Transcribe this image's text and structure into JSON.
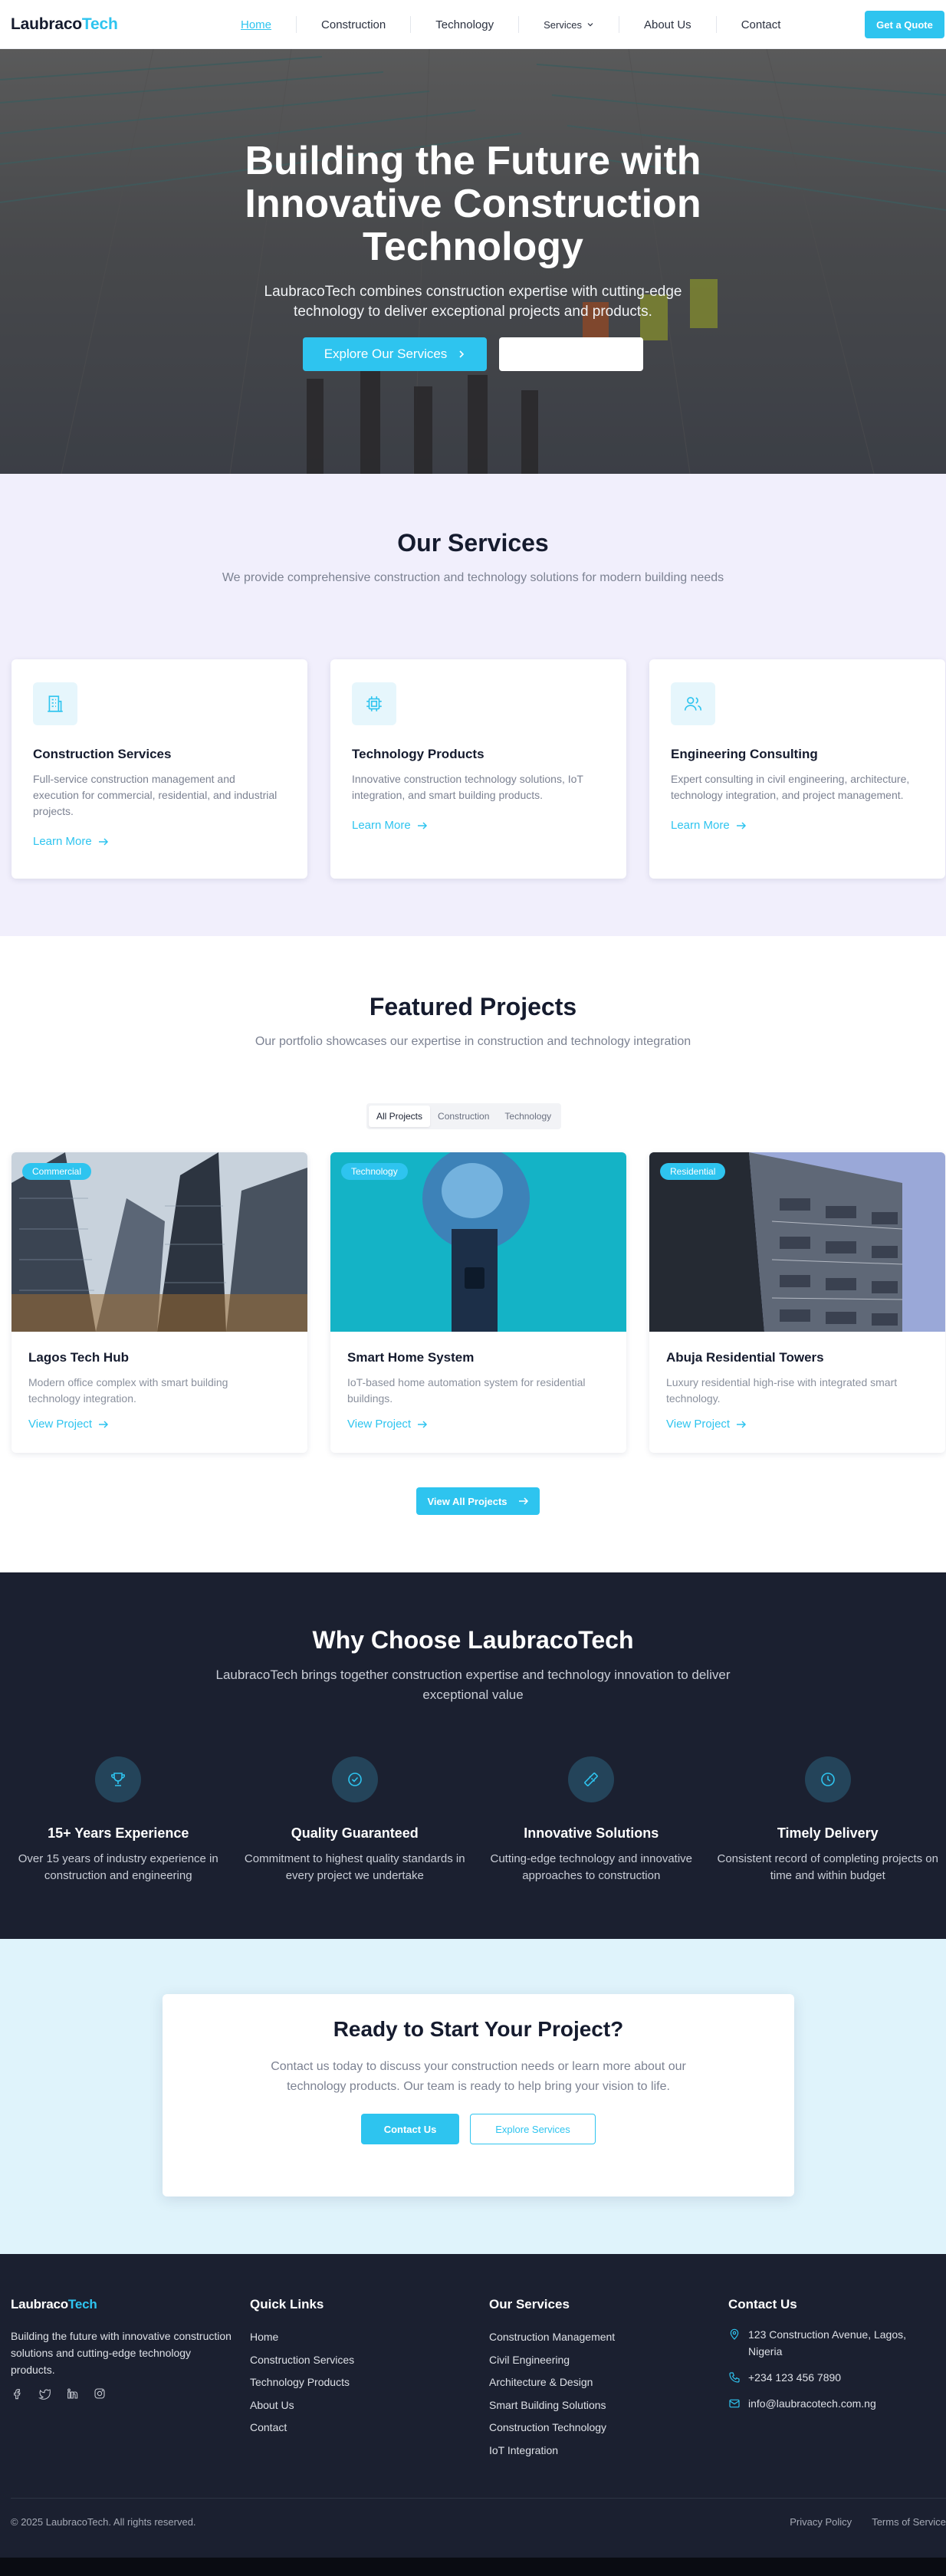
{
  "brand": {
    "part1": "Laubraco",
    "part2": "Tech"
  },
  "nav": {
    "items": [
      "Home",
      "Construction",
      "Technology",
      "Services",
      "About Us",
      "Contact"
    ],
    "quote_label": "Get a Quote"
  },
  "hero": {
    "title": "Building the Future with Innovative Construction Technology",
    "subtitle": "LaubracoTech combines construction expertise with cutting-edge technology to deliver exceptional projects and products.",
    "primary_label": "Explore Our Services"
  },
  "services": {
    "title": "Our Services",
    "subtitle": "We provide comprehensive construction and technology solutions for modern building needs",
    "cards": [
      {
        "title": "Construction Services",
        "desc": "Full-service construction management and execution for commercial, residential, and industrial projects.",
        "link": "Learn More",
        "icon": "building-icon"
      },
      {
        "title": "Technology Products",
        "desc": "Innovative construction technology solutions, IoT integration, and smart building products.",
        "link": "Learn More",
        "icon": "chip-icon"
      },
      {
        "title": "Engineering Consulting",
        "desc": "Expert consulting in civil engineering, architecture, technology integration, and project management.",
        "link": "Learn More",
        "icon": "users-icon"
      }
    ]
  },
  "projects": {
    "title": "Featured Projects",
    "subtitle": "Our portfolio showcases our expertise in construction and technology integration",
    "filters": [
      "All Projects",
      "Construction",
      "Technology"
    ],
    "active_filter": "All Projects",
    "cards": [
      {
        "tag": "Commercial",
        "title": "Lagos Tech Hub",
        "desc": "Modern office complex with smart building technology integration.",
        "link": "View Project"
      },
      {
        "tag": "Technology",
        "title": "Smart Home System",
        "desc": "IoT-based home automation system for residential buildings.",
        "link": "View Project"
      },
      {
        "tag": "Residential",
        "title": "Abuja Residential Towers",
        "desc": "Luxury residential high-rise with integrated smart technology.",
        "link": "View Project"
      }
    ],
    "view_all_label": "View All Projects"
  },
  "why": {
    "title": "Why Choose LaubracoTech",
    "subtitle": "LaubracoTech brings together construction expertise and technology innovation to deliver exceptional value",
    "items": [
      {
        "title": "15+ Years Experience",
        "desc": "Over 15 years of industry experience in construction and engineering",
        "icon": "trophy-icon"
      },
      {
        "title": "Quality Guaranteed",
        "desc": "Commitment to highest quality standards in every project we undertake",
        "icon": "check-circle-icon"
      },
      {
        "title": "Innovative Solutions",
        "desc": "Cutting-edge technology and innovative approaches to construction",
        "icon": "ruler-icon"
      },
      {
        "title": "Timely Delivery",
        "desc": "Consistent record of completing projects on time and within budget",
        "icon": "clock-icon"
      }
    ]
  },
  "cta": {
    "title": "Ready to Start Your Project?",
    "text": "Contact us today to discuss your construction needs or learn more about our technology products. Our team is ready to help bring your vision to life.",
    "primary_label": "Contact Us",
    "secondary_label": "Explore Services"
  },
  "footer": {
    "about": "Building the future with innovative construction solutions and cutting-edge technology products.",
    "quick_links_title": "Quick Links",
    "quick_links": [
      "Home",
      "Construction Services",
      "Technology Products",
      "About Us",
      "Contact"
    ],
    "services_title": "Our Services",
    "services": [
      "Construction Management",
      "Civil Engineering",
      "Architecture & Design",
      "Smart Building Solutions",
      "Construction Technology",
      "IoT Integration"
    ],
    "contact_title": "Contact Us",
    "address": "123 Construction Avenue, Lagos, Nigeria",
    "phone": "+234 123 456 7890",
    "email": "info@laubracotech.com.ng",
    "copyright": "© 2025 LaubracoTech. All rights reserved.",
    "privacy": "Privacy Policy",
    "terms": "Terms of Service"
  },
  "colors": {
    "accent": "#2ec4ef",
    "dark": "#1b2030",
    "services_bg": "#f1effc",
    "cta_bg": "#dff3fb"
  }
}
